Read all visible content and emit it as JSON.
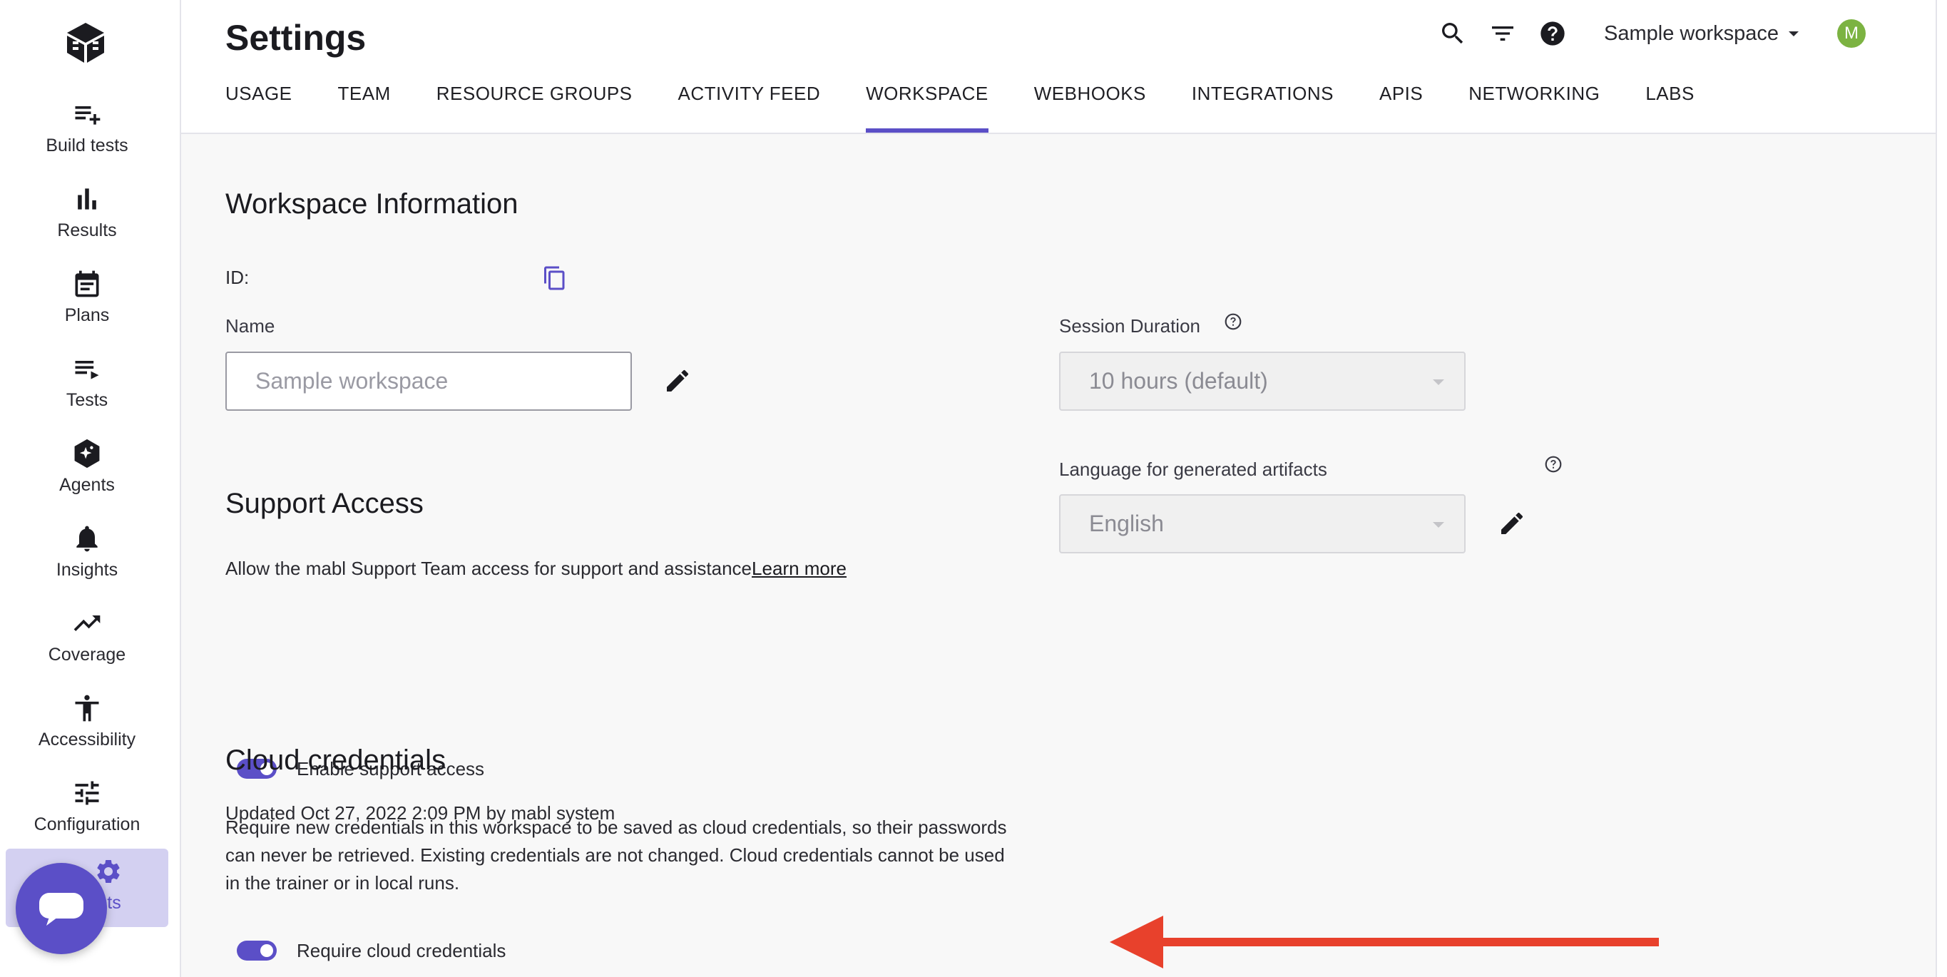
{
  "sidebar": {
    "items": [
      {
        "label": "Build tests",
        "icon": "build-tests-icon"
      },
      {
        "label": "Results",
        "icon": "bar-chart-icon"
      },
      {
        "label": "Plans",
        "icon": "calendar-icon"
      },
      {
        "label": "Tests",
        "icon": "list-icon"
      },
      {
        "label": "Agents",
        "icon": "sparkle-hexagon-icon"
      },
      {
        "label": "Insights",
        "icon": "bell-icon"
      },
      {
        "label": "Coverage",
        "icon": "trending-up-icon"
      },
      {
        "label": "Accessibility",
        "icon": "accessibility-icon"
      },
      {
        "label": "Configuration",
        "icon": "sliders-icon"
      },
      {
        "label": "ts",
        "icon": "gear-icon"
      }
    ],
    "accent_color": "#5b4fc7"
  },
  "header": {
    "title": "Settings",
    "tabs": [
      {
        "label": "USAGE"
      },
      {
        "label": "TEAM"
      },
      {
        "label": "RESOURCE GROUPS"
      },
      {
        "label": "ACTIVITY FEED"
      },
      {
        "label": "WORKSPACE",
        "active": true
      },
      {
        "label": "WEBHOOKS"
      },
      {
        "label": "INTEGRATIONS"
      },
      {
        "label": "APIS"
      },
      {
        "label": "NETWORKING"
      },
      {
        "label": "LABS"
      }
    ],
    "workspace": "Sample workspace",
    "avatar_initial": "M"
  },
  "workspace_info": {
    "title": "Workspace Information",
    "id_label": "ID:",
    "name_label": "Name",
    "name_placeholder": "Sample workspace",
    "session_label": "Session Duration",
    "session_value": "10 hours (default)",
    "language_label": "Language for generated artifacts",
    "language_value": "English"
  },
  "support_access": {
    "title": "Support Access",
    "description": "Allow the mabl Support Team access for support and assistance",
    "learn_more": "Learn more",
    "toggle_label": "Enable support access",
    "toggle_on": true,
    "updated": "Updated Oct 27, 2022 2:09 PM by mabl system"
  },
  "cloud_credentials": {
    "title": "Cloud credentials",
    "description_lines": [
      "Require new credentials in this workspace to be saved as cloud credentials, so their passwords",
      "can never be retrieved. Existing credentials are not changed. Cloud credentials cannot be used",
      "in the trainer or in local runs."
    ],
    "toggle_label": "Require cloud credentials",
    "toggle_on": true
  },
  "colors": {
    "accent": "#5b4fc7",
    "annotation_arrow": "#e8412c",
    "avatar": "#7cb342"
  }
}
